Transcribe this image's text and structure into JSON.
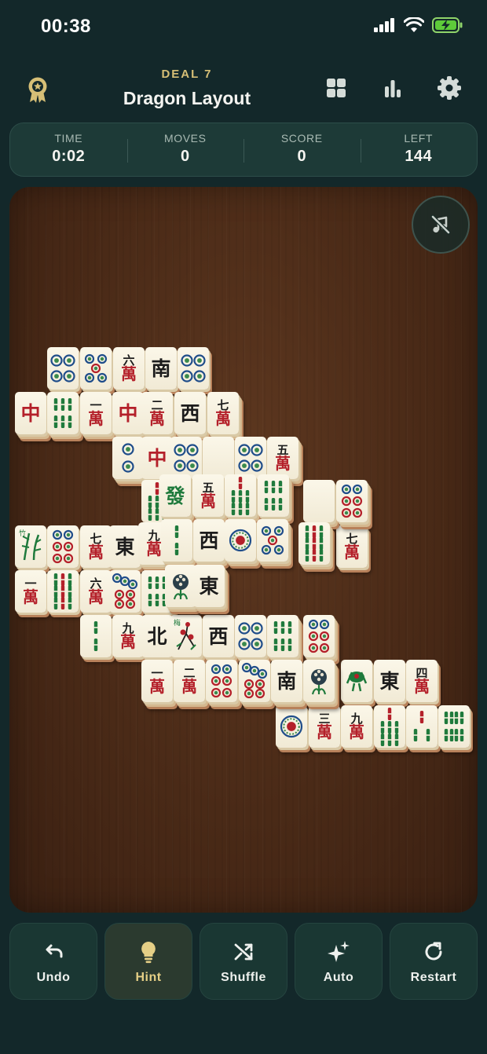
{
  "status_bar": {
    "time": "00:38",
    "icons": [
      "cellular-signal-icon",
      "wifi-icon",
      "battery-charging-icon"
    ]
  },
  "header": {
    "deal_label": "DEAL 7",
    "title": "Dragon Layout",
    "icons": [
      "ribbon-badge-icon",
      "grid-icon",
      "bar-chart-icon",
      "gear-icon"
    ],
    "colors": {
      "accent_gold": "#d6bf76",
      "background": "#13282a"
    }
  },
  "stats": [
    {
      "label": "TIME",
      "value": "0:02"
    },
    {
      "label": "MOVES",
      "value": "0"
    },
    {
      "label": "SCORE",
      "value": "0"
    },
    {
      "label": "LEFT",
      "value": "144"
    }
  ],
  "board": {
    "sound_button_icon": "music-muted-icon",
    "tiles": [
      {
        "t": "c4"
      },
      {
        "t": "c5"
      },
      {
        "t": "m6"
      },
      {
        "t": "S"
      },
      {
        "t": "c4"
      },
      {
        "t": "R"
      },
      {
        "t": "b6"
      },
      {
        "t": "m1"
      },
      {
        "t": "R"
      },
      {
        "t": "m2"
      },
      {
        "t": "W"
      },
      {
        "t": "m7"
      },
      {
        "t": "c2"
      },
      {
        "t": "R"
      },
      {
        "t": "c4"
      },
      {
        "t": "blank"
      },
      {
        "t": "c4"
      },
      {
        "t": "m5"
      },
      {
        "t": "b7"
      },
      {
        "t": "G"
      },
      {
        "t": "m5"
      },
      {
        "t": "b7"
      },
      {
        "t": "b6"
      },
      {
        "t": "blank"
      },
      {
        "t": "c6"
      },
      {
        "t": "f"
      },
      {
        "t": "c6"
      },
      {
        "t": "m7"
      },
      {
        "t": "E"
      },
      {
        "t": "m9"
      },
      {
        "t": "b2"
      },
      {
        "t": "W"
      },
      {
        "t": "c1"
      },
      {
        "t": "c5"
      },
      {
        "t": "b9"
      },
      {
        "t": "m7"
      },
      {
        "t": "m1"
      },
      {
        "t": "b9"
      },
      {
        "t": "m6"
      },
      {
        "t": "c7"
      },
      {
        "t": "b6"
      },
      {
        "t": "fl"
      },
      {
        "t": "E"
      },
      {
        "t": "b2"
      },
      {
        "t": "m9"
      },
      {
        "t": "N"
      },
      {
        "t": "pl"
      },
      {
        "t": "W"
      },
      {
        "t": "c4"
      },
      {
        "t": "b6"
      },
      {
        "t": "c6"
      },
      {
        "t": "m1"
      },
      {
        "t": "m2"
      },
      {
        "t": "c6"
      },
      {
        "t": "c7"
      },
      {
        "t": "S"
      },
      {
        "t": "fl"
      },
      {
        "t": "b1"
      },
      {
        "t": "E"
      },
      {
        "t": "m4"
      },
      {
        "t": "c1"
      },
      {
        "t": "m3"
      },
      {
        "t": "m9"
      },
      {
        "t": "b7"
      },
      {
        "t": "b3"
      },
      {
        "t": "b8"
      }
    ]
  },
  "toolbar": {
    "buttons": [
      {
        "label": "Undo",
        "icon": "undo-icon"
      },
      {
        "label": "Hint",
        "icon": "lightbulb-icon"
      },
      {
        "label": "Shuffle",
        "icon": "shuffle-icon"
      },
      {
        "label": "Auto",
        "icon": "sparkles-icon"
      },
      {
        "label": "Restart",
        "icon": "restart-icon"
      }
    ]
  }
}
